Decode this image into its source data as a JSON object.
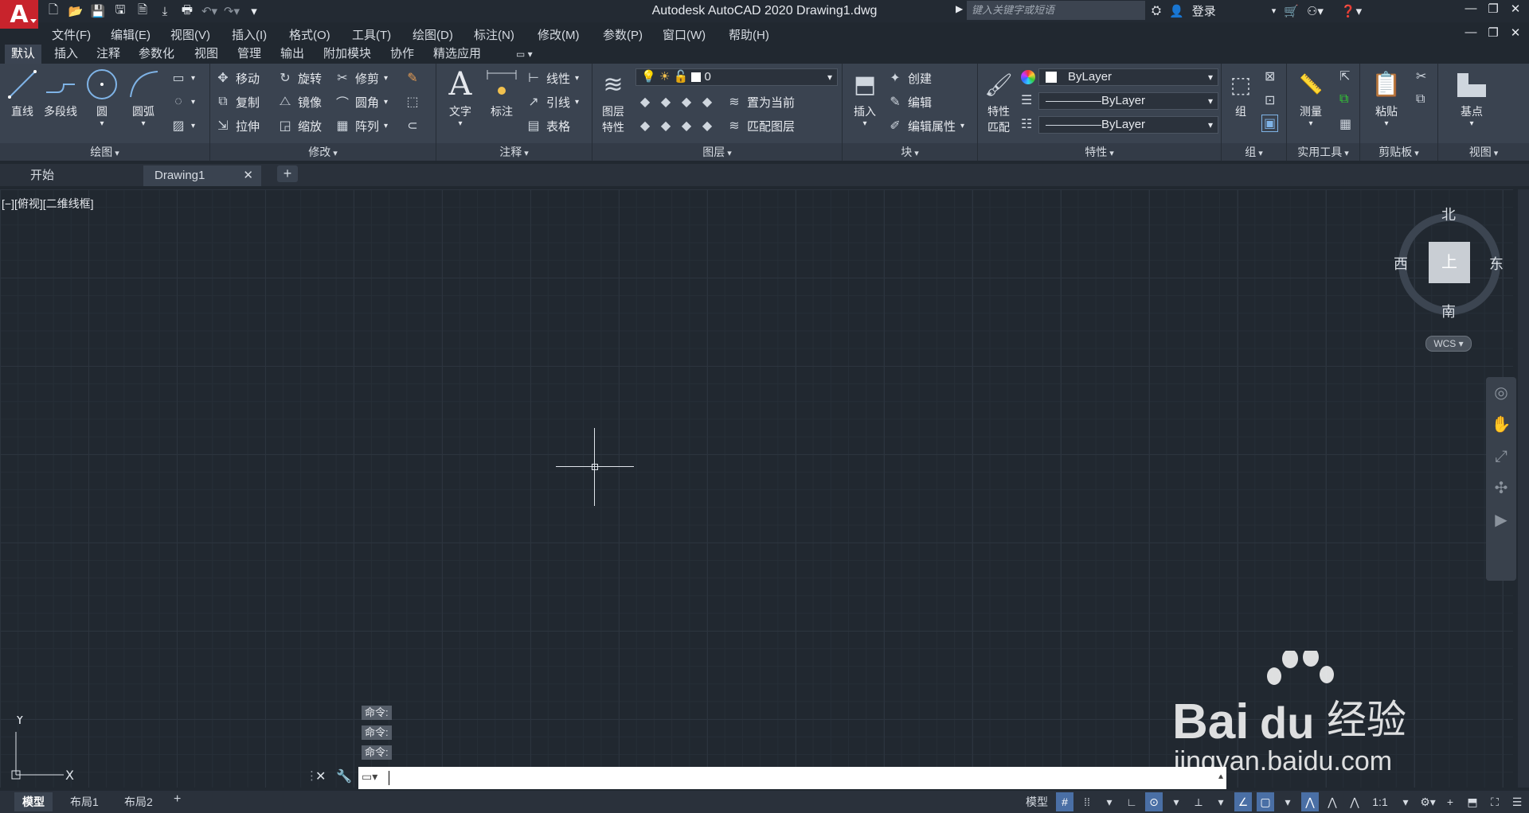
{
  "titlebar": {
    "logo": "A",
    "title": "Autodesk AutoCAD 2020    Drawing1.dwg",
    "search_placeholder": "键入关键字或短语",
    "login": "登录"
  },
  "menubar": [
    "文件(F)",
    "编辑(E)",
    "视图(V)",
    "插入(I)",
    "格式(O)",
    "工具(T)",
    "绘图(D)",
    "标注(N)",
    "修改(M)",
    "参数(P)",
    "窗口(W)",
    "帮助(H)"
  ],
  "ribbon_tabs": [
    "默认",
    "插入",
    "注释",
    "参数化",
    "视图",
    "管理",
    "输出",
    "附加模块",
    "协作",
    "精选应用"
  ],
  "panels": {
    "draw": {
      "title": "绘图",
      "line": "直线",
      "polyline": "多段线",
      "circle": "圆",
      "arc": "圆弧"
    },
    "modify": {
      "title": "修改",
      "move": "移动",
      "rotate": "旋转",
      "trim": "修剪",
      "copy": "复制",
      "mirror": "镜像",
      "fillet": "圆角",
      "stretch": "拉伸",
      "scale": "缩放",
      "array": "阵列"
    },
    "annotation": {
      "title": "注释",
      "text": "文字",
      "dimension": "标注",
      "linear": "线性",
      "leader": "引线",
      "table": "表格"
    },
    "layers": {
      "title": "图层",
      "layer_props_1": "图层",
      "layer_props_2": "特性",
      "current_layer": "0",
      "set_current": "置为当前",
      "match_layer": "匹配图层"
    },
    "block": {
      "title": "块",
      "insert": "插入",
      "create": "创建",
      "edit": "编辑",
      "edit_attr": "编辑属性"
    },
    "properties": {
      "title": "特性",
      "match_1": "特性",
      "match_2": "匹配",
      "color": "ByLayer",
      "linetype": "ByLayer",
      "lineweight": "ByLayer"
    },
    "groups": {
      "title": "组",
      "group": "组"
    },
    "utilities": {
      "title": "实用工具",
      "measure": "测量"
    },
    "clipboard": {
      "title": "剪贴板",
      "paste": "粘贴"
    },
    "view": {
      "title": "视图",
      "base": "基点"
    }
  },
  "doc_tabs": [
    "开始",
    "Drawing1"
  ],
  "viewport_label": "[−][俯视][二维线框]",
  "viewcube": {
    "north": "北",
    "south": "南",
    "east": "东",
    "west": "西",
    "top": "上",
    "wcs": "WCS"
  },
  "ucs": {
    "x": "X",
    "y": "Y"
  },
  "command_history": [
    "命令:",
    "命令:",
    "命令:"
  ],
  "status_tabs": [
    "模型",
    "布局1",
    "布局2"
  ],
  "status": {
    "model": "模型",
    "scale": "1:1"
  },
  "watermark": {
    "brand": "Bai",
    "brand2": "du",
    "jingyan": "经验",
    "url": "jingyan.baidu.com"
  }
}
